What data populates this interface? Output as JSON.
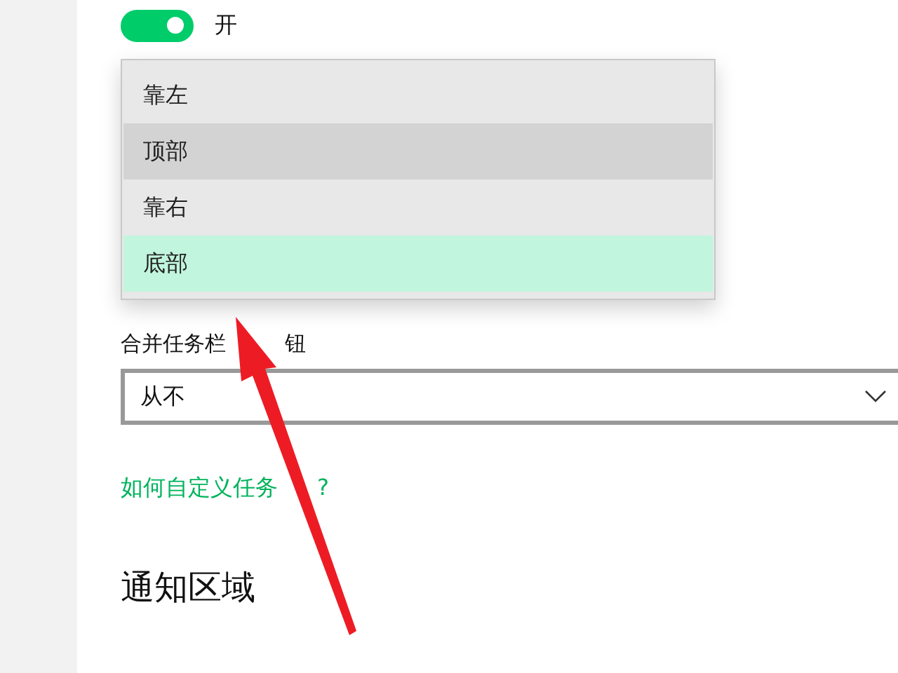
{
  "toggle": {
    "on": true,
    "label": "开"
  },
  "dropdown_menu": {
    "items": [
      {
        "label": "靠左",
        "hovered": false,
        "selected": false
      },
      {
        "label": "顶部",
        "hovered": true,
        "selected": false
      },
      {
        "label": "靠右",
        "hovered": false,
        "selected": false
      },
      {
        "label": "底部",
        "hovered": false,
        "selected": true
      }
    ]
  },
  "combine_buttons": {
    "label_parts": [
      "合并任务栏",
      "钮"
    ],
    "value": "从不"
  },
  "help_link_parts": [
    "如何自定义任务",
    "?"
  ],
  "section_heading": "通知区域",
  "annotation": {
    "kind": "arrow"
  }
}
